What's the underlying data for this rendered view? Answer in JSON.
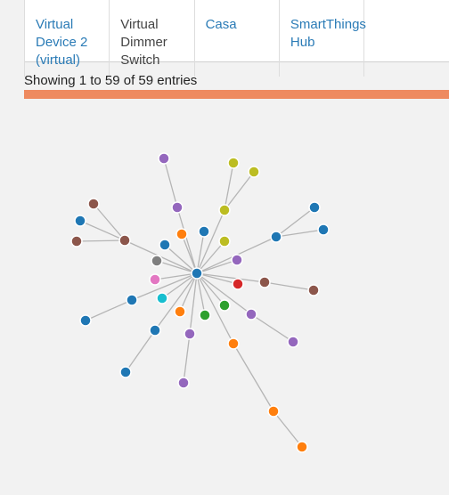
{
  "table": {
    "row": [
      {
        "text": "Virtual Device 2 (virtual)",
        "link": true
      },
      {
        "text": "Virtual Dimmer Switch",
        "link": false
      },
      {
        "text": "Casa",
        "link": true
      },
      {
        "text": "SmartThings Hub",
        "link": true
      },
      {
        "text": "",
        "link": false
      }
    ]
  },
  "info": "Showing 1 to 59 of 59 entries",
  "colors": {
    "link": "#2a7bb6",
    "bar": "#ee8a60",
    "edge": "#b5b5b5",
    "blue": "#1f77b4",
    "orange": "#ff7f0e",
    "green": "#2ca02c",
    "red": "#d62728",
    "purple": "#9467bd",
    "brown": "#8c564b",
    "pink": "#e377c2",
    "gray": "#7f7f7f",
    "olive": "#bcbd22",
    "cyan": "#17becf"
  },
  "graph": {
    "node_count": 36
  }
}
